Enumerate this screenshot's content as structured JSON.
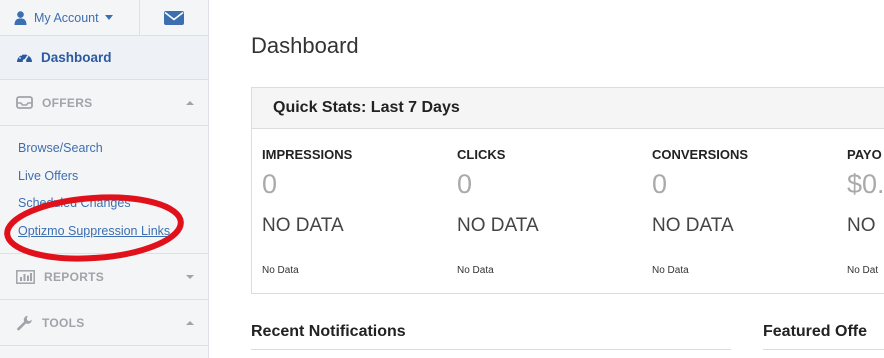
{
  "sidebar": {
    "account_label": "My Account",
    "dashboard_label": "Dashboard",
    "offers": {
      "label": "OFFERS",
      "items": [
        {
          "label": "Browse/Search"
        },
        {
          "label": "Live Offers"
        },
        {
          "label": "Scheduled Changes"
        },
        {
          "label": "Optizmo Suppression Links"
        }
      ]
    },
    "reports_label": "REPORTS",
    "tools_label": "TOOLS"
  },
  "main": {
    "title": "Dashboard",
    "quick_stats": {
      "title": "Quick Stats: Last 7 Days",
      "stats": [
        {
          "heading": "IMPRESSIONS",
          "value": "0",
          "status": "NO DATA",
          "small": "No Data"
        },
        {
          "heading": "CLICKS",
          "value": "0",
          "status": "NO DATA",
          "small": "No Data"
        },
        {
          "heading": "CONVERSIONS",
          "value": "0",
          "status": "NO DATA",
          "small": "No Data"
        },
        {
          "heading": "PAYO",
          "value": "$0.",
          "status": "NO",
          "small": "No Dat"
        }
      ]
    },
    "recent_notifications_title": "Recent Notifications",
    "featured_offers_title": "Featured Offe"
  },
  "colors": {
    "link_blue": "#3d6fb0",
    "highlight_red": "#e0111b",
    "sidebar_bg": "#f4f5f7"
  },
  "icons": [
    "user-icon",
    "envelope-icon",
    "dashboard-gauge-icon",
    "offers-icon",
    "reports-bar-chart-icon",
    "wrench-icon"
  ]
}
